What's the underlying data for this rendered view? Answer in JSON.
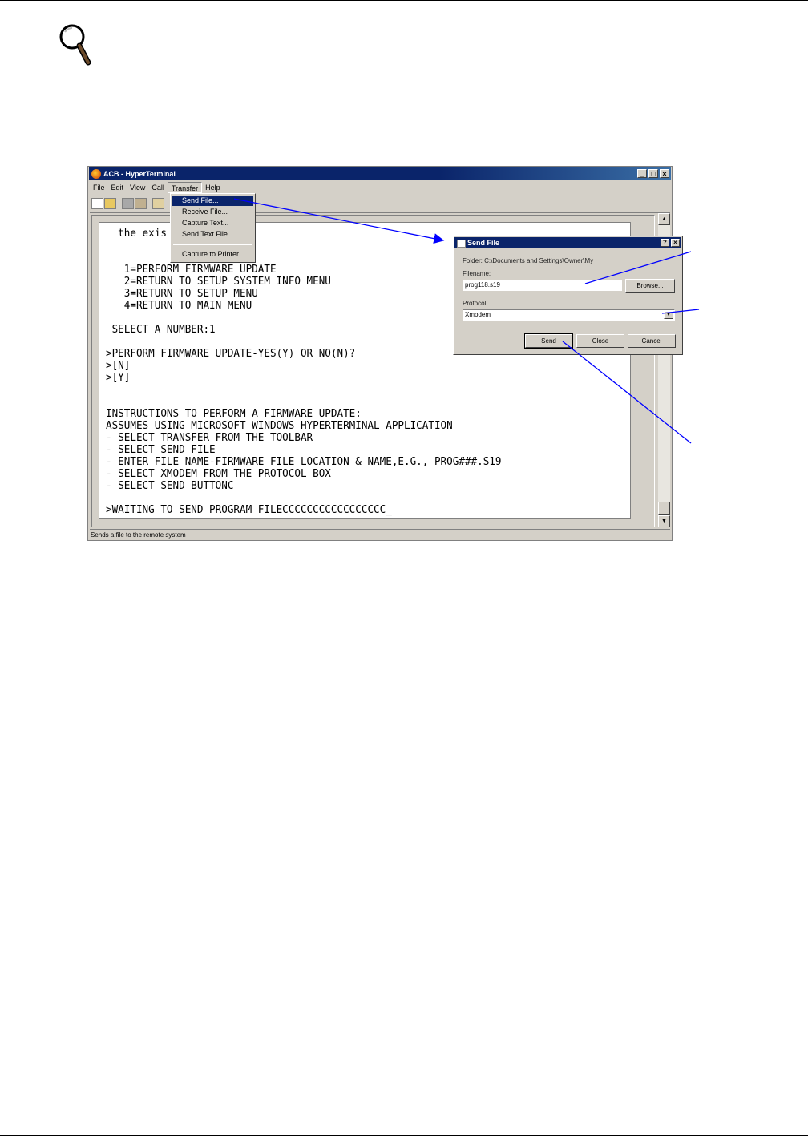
{
  "window": {
    "title": "ACB - HyperTerminal",
    "caption_buttons": {
      "minimize": "_",
      "maximize": "□",
      "close": "×"
    }
  },
  "menubar": {
    "items": [
      "File",
      "Edit",
      "View",
      "Call",
      "Transfer",
      "Help"
    ]
  },
  "transfer_menu": {
    "items": [
      "Send File...",
      "Receive File...",
      "Capture Text...",
      "Send Text File...",
      "Capture to Printer"
    ],
    "selected": "Send File..."
  },
  "terminal": {
    "lines": [
      "  the exis",
      "",
      "",
      "   1=PERFORM FIRMWARE UPDATE",
      "   2=RETURN TO SETUP SYSTEM INFO MENU",
      "   3=RETURN TO SETUP MENU",
      "   4=RETURN TO MAIN MENU",
      "",
      " SELECT A NUMBER:1",
      "",
      ">PERFORM FIRMWARE UPDATE-YES(Y) OR NO(N)?",
      ">[N]",
      ">[Y]",
      "",
      "",
      "INSTRUCTIONS TO PERFORM A FIRMWARE UPDATE:",
      "ASSUMES USING MICROSOFT WINDOWS HYPERTERMINAL APPLICATION",
      "- SELECT TRANSFER FROM THE TOOLBAR",
      "- SELECT SEND FILE",
      "- ENTER FILE NAME-FIRMWARE FILE LOCATION & NAME,E.G., PROG###.S19",
      "- SELECT XMODEM FROM THE PROTOCOL BOX",
      "- SELECT SEND BUTTONC",
      "",
      ">WAITING TO SEND PROGRAM FILECCCCCCCCCCCCCCCCC_"
    ]
  },
  "statusbar": {
    "text": "Sends a file to the remote system"
  },
  "send_dialog": {
    "title": "Send File",
    "help_btn": "?",
    "close_btn": "×",
    "folder_label": "Folder: C:\\Documents and Settings\\Owner\\My",
    "filename_label": "Filename:",
    "filename_value": "prog118.s19",
    "browse_label": "Browse...",
    "protocol_label": "Protocol:",
    "protocol_value": "Xmodem",
    "send_label": "Send",
    "close_label": "Close",
    "cancel_label": "Cancel"
  },
  "colors": {
    "titlebar": "#0a246a",
    "face": "#d4d0c8",
    "callout": "#0000ff"
  }
}
